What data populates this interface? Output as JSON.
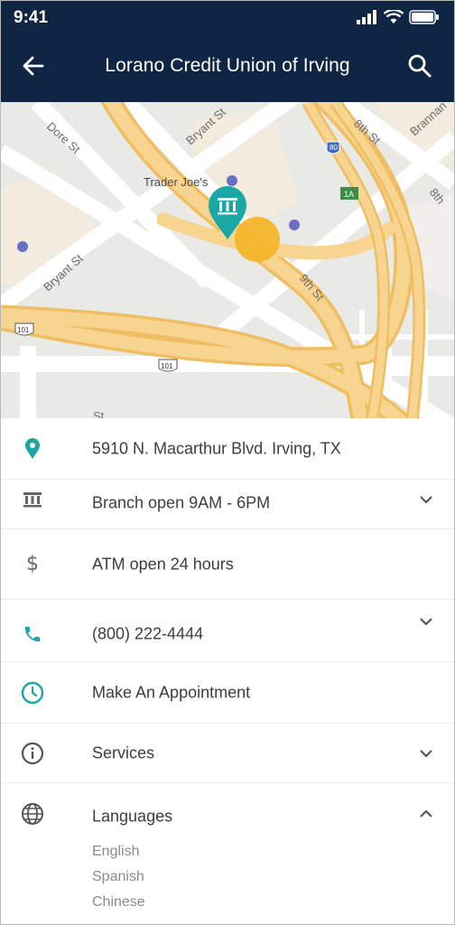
{
  "status_bar": {
    "time": "9:41"
  },
  "header": {
    "title": "Lorano Credit Union of Irving"
  },
  "map": {
    "labels": {
      "dore": "Dore St",
      "bryant_top": "Bryant St",
      "bryant_left": "Bryant St",
      "eighth": "8th St",
      "brannan": "Brannan",
      "ninth": "9th St",
      "eighth_right": "8th",
      "traderjoes": "Trader Joe's",
      "hwy80": "80",
      "exit1a": "1A",
      "hwy101_left": "101",
      "hwy101_mid": "101",
      "bottom_st": "St"
    }
  },
  "details": {
    "address": "5910 N. Macarthur Blvd. Irving, TX",
    "branch_hours": "Branch open 9AM - 6PM",
    "atm_hours": "ATM open 24 hours",
    "phone": "(800) 222-4444",
    "appointment": "Make An Appointment",
    "services": "Services",
    "languages": {
      "label": "Languages",
      "items": [
        "English",
        "Spanish",
        "Chinese"
      ]
    }
  },
  "colors": {
    "header": "#0f2544",
    "accent": "#1aa7a5",
    "road": "#f6cd7e",
    "location_dot": "#f4b52b"
  }
}
